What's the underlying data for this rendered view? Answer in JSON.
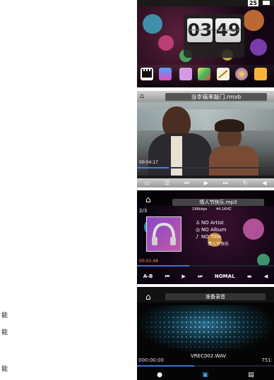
{
  "side_chars": [
    "能",
    "能",
    "能"
  ],
  "home": {
    "badge": "25",
    "clock": {
      "hour": "03",
      "minute": "49"
    }
  },
  "video": {
    "file_name": "当幸福来敲门.rmvb",
    "elapsed": "00:04:17",
    "progress": 0.23
  },
  "music": {
    "file_name": "情人节快乐.mp3",
    "track_index": "2/3",
    "bitrate": "196kbps",
    "sample_rate": "44.1KHZ",
    "artist": "NO Artist",
    "album": "NO Album",
    "title": "NO Title",
    "lyric": "情人节快乐",
    "elapsed": "00:02:48",
    "eq_label": "A-B",
    "mode": "NOMAL",
    "progress": 0.38
  },
  "recorder": {
    "title": "准备录音",
    "elapsed": "000:00:00",
    "total": "751:",
    "file_name": "VREC002.WAV",
    "progress": 0.42
  }
}
